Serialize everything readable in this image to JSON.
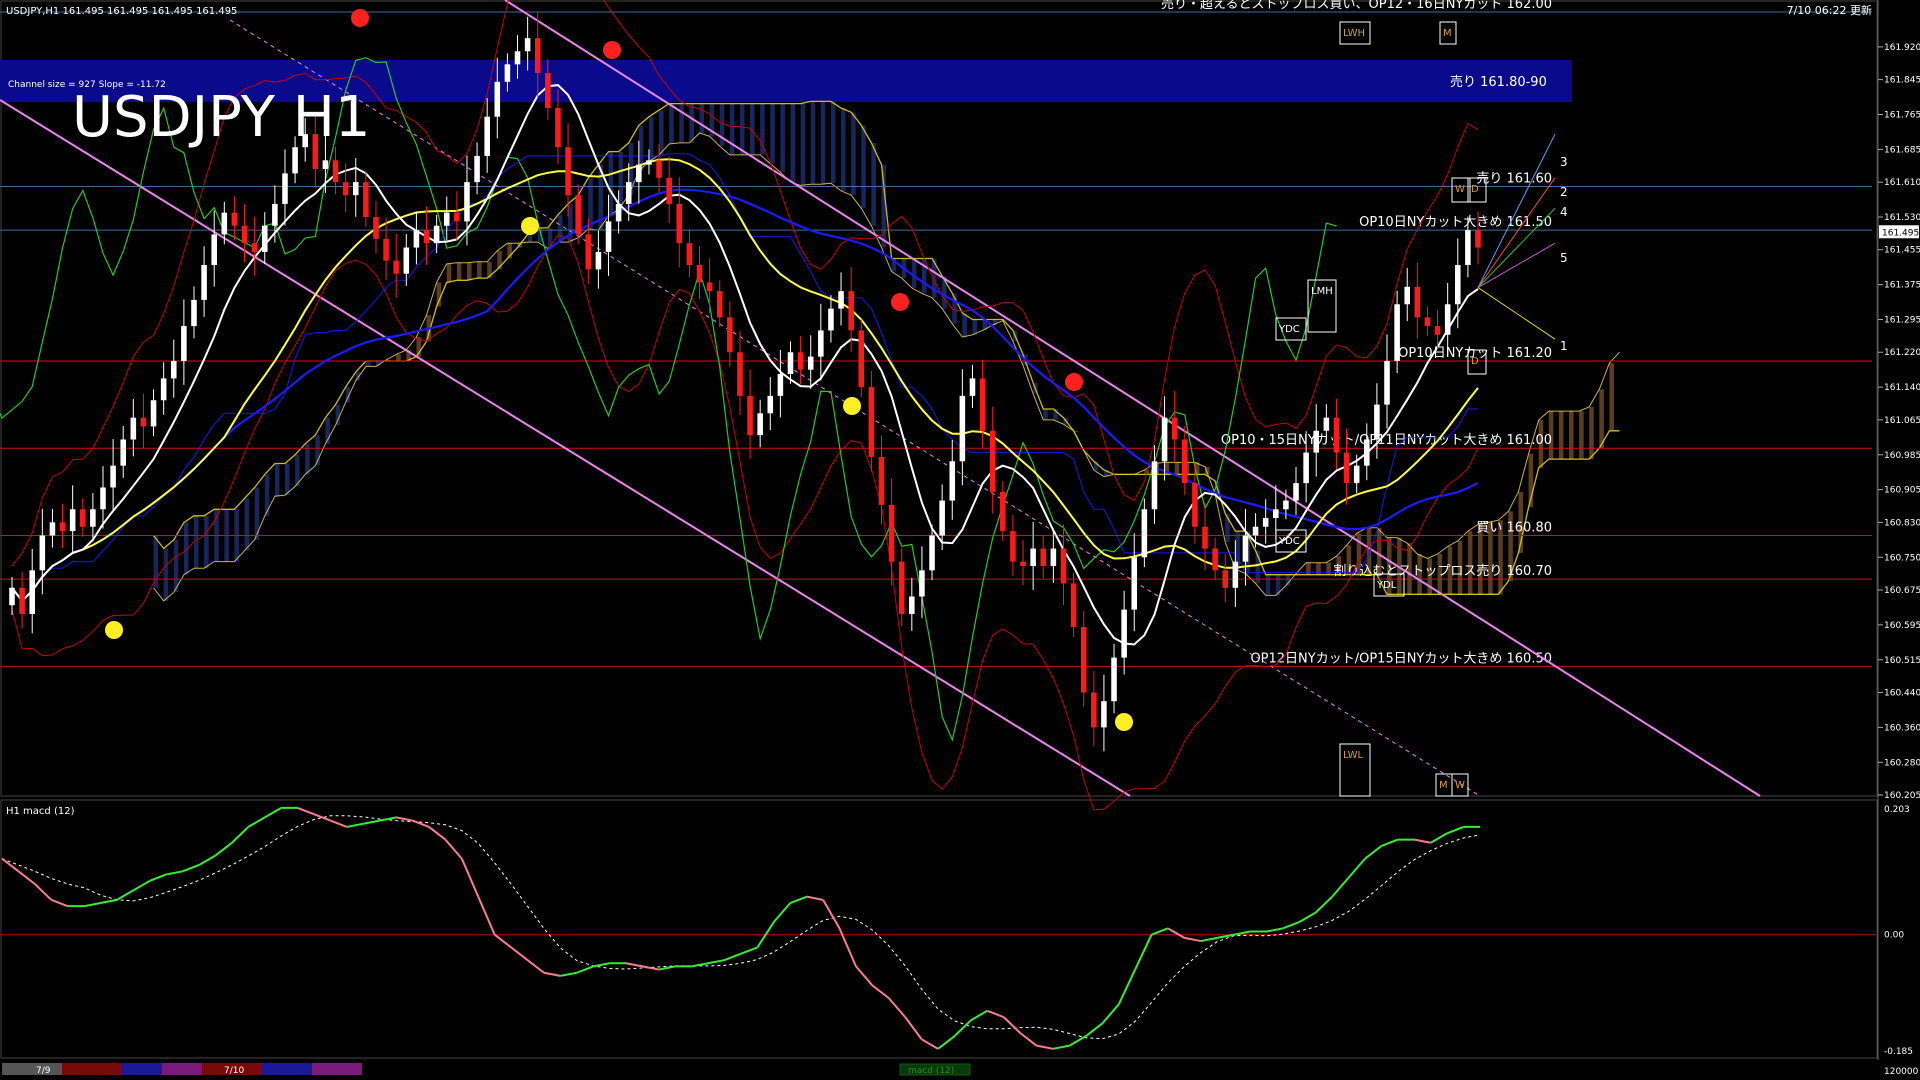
{
  "window": {
    "symbol_info": "USDJPY,H1  161.495 161.495 161.495 161.495",
    "updated": "7/10 06:22 更新",
    "channel_info": "Channel size = 927  Slope = -11.72",
    "big_title": "USDJPY H1",
    "sub_title": "H1  macd (12)",
    "macd_tab": "macd (12)"
  },
  "colors": {
    "background": "#000000",
    "bull_candle": "#ffffff",
    "bear_candle": "#ff1a1a",
    "sell_zone": "#0a0a8c",
    "ma_white": "#ffffff",
    "ma_yellow": "#ffff33",
    "ma_blue": "#1a1aff",
    "channel": "#ee82ee",
    "chikou": "#22cc22",
    "bollinger": "#cc0000",
    "kumo_bull": "#cc8844",
    "kumo_bear": "#3355cc",
    "macd_up": "#33ee33",
    "macd_down": "#ff7a90",
    "signal": "#ffffff",
    "ref_blue": "#3a6ea5",
    "ref_red": "#d01010",
    "marker_gold": "#d6a020"
  },
  "chart_data": {
    "type": "candlestick",
    "title": "USDJPY H1",
    "price_axis": {
      "min": 160.205,
      "max": 162.0,
      "labels": [
        "161.920",
        "161.845",
        "161.765",
        "161.685",
        "161.610",
        "161.530",
        "161.455",
        "161.375",
        "161.295",
        "161.220",
        "161.140",
        "161.065",
        "160.985",
        "160.905",
        "160.830",
        "160.750",
        "160.675",
        "160.595",
        "160.515",
        "160.440",
        "160.360",
        "160.280",
        "160.205"
      ],
      "current_price": "161.495"
    },
    "time_axis": {
      "labels": [
        "7/9",
        "7/10"
      ]
    },
    "levels": [
      {
        "price": 162.0,
        "label": "売り・超えるとストップロス買い、OP12・16日NYカット 162.00",
        "style": "blue"
      },
      {
        "price": 161.6,
        "label": "売り 161.60",
        "style": "blue"
      },
      {
        "price": 161.5,
        "label": "OP10日NYカット大きめ 161.50",
        "style": "blue"
      },
      {
        "price": 161.2,
        "label": "OP10日NYカット 161.20",
        "style": "red"
      },
      {
        "price": 161.0,
        "label": "OP10・15日NYカット/OP11日NYカット大きめ 161.00",
        "style": "red"
      },
      {
        "price": 160.8,
        "label": "買い 160.80",
        "style": "red"
      },
      {
        "price": 160.7,
        "label": "割り込むとストップロス売り 160.70",
        "style": "red"
      },
      {
        "price": 160.5,
        "label": "OP12日NYカット/OP15日NYカット大きめ 160.50",
        "style": "red"
      }
    ],
    "sell_zone": {
      "low": 161.8,
      "high": 161.9,
      "label": "売り 161.80-90"
    },
    "markers": [
      "LWH",
      "M",
      "YDC",
      "LMH",
      "YDC",
      "YDL",
      "LWL",
      "M",
      "W",
      "W",
      "D",
      "D"
    ],
    "projection_labels": [
      "3",
      "2",
      "4",
      "5",
      "1"
    ],
    "close": [
      160.68,
      160.62,
      160.72,
      160.8,
      160.83,
      160.81,
      160.86,
      160.82,
      160.86,
      160.91,
      160.96,
      161.02,
      161.07,
      161.05,
      161.11,
      161.16,
      161.2,
      161.28,
      161.34,
      161.42,
      161.49,
      161.54,
      161.51,
      161.47,
      161.45,
      161.51,
      161.56,
      161.63,
      161.69,
      161.72,
      161.64,
      161.66,
      161.61,
      161.58,
      161.61,
      161.53,
      161.48,
      161.43,
      161.4,
      161.46,
      161.5,
      161.47,
      161.51,
      161.54,
      161.52,
      161.61,
      161.67,
      161.76,
      161.84,
      161.88,
      161.91,
      161.94,
      161.86,
      161.78,
      161.69,
      161.58,
      161.49,
      161.41,
      161.45,
      161.52,
      161.56,
      161.61,
      161.65,
      161.66,
      161.62,
      161.56,
      161.47,
      161.42,
      161.38,
      161.36,
      161.3,
      161.22,
      161.12,
      161.03,
      161.08,
      161.12,
      161.17,
      161.22,
      161.18,
      161.21,
      161.27,
      161.32,
      161.36,
      161.27,
      161.14,
      160.98,
      160.87,
      160.74,
      160.62,
      160.66,
      160.72,
      160.8,
      160.88,
      160.97,
      161.12,
      161.16,
      161.04,
      160.9,
      160.81,
      160.74,
      160.73,
      160.77,
      160.73,
      160.77,
      160.69,
      160.59,
      160.44,
      160.36,
      160.42,
      160.52,
      160.63,
      160.75,
      160.86,
      160.97,
      161.07,
      161.02,
      160.92,
      160.82,
      160.77,
      160.72,
      160.68,
      160.74,
      160.8,
      160.82,
      160.84,
      160.86,
      160.88,
      160.92,
      160.99,
      161.04,
      161.07,
      160.99,
      160.92,
      160.96,
      161.02,
      161.1,
      161.2,
      161.33,
      161.37,
      161.3,
      161.28,
      161.26,
      161.33,
      161.42,
      161.5,
      161.46
    ],
    "macd": [
      0.12,
      0.1,
      0.08,
      0.055,
      0.045,
      0.045,
      0.05,
      0.055,
      0.07,
      0.085,
      0.095,
      0.1,
      0.11,
      0.125,
      0.145,
      0.17,
      0.185,
      0.2,
      0.2,
      0.19,
      0.18,
      0.17,
      0.175,
      0.18,
      0.185,
      0.18,
      0.17,
      0.15,
      0.12,
      0.06,
      0.0,
      -0.02,
      -0.04,
      -0.06,
      -0.065,
      -0.06,
      -0.05,
      -0.045,
      -0.045,
      -0.05,
      -0.055,
      -0.05,
      -0.05,
      -0.045,
      -0.04,
      -0.03,
      -0.02,
      0.02,
      0.05,
      0.06,
      0.055,
      0.01,
      -0.05,
      -0.08,
      -0.1,
      -0.13,
      -0.165,
      -0.18,
      -0.16,
      -0.135,
      -0.12,
      -0.13,
      -0.155,
      -0.175,
      -0.18,
      -0.175,
      -0.16,
      -0.14,
      -0.11,
      -0.055,
      0.0,
      0.01,
      -0.005,
      -0.01,
      -0.005,
      0.0,
      0.005,
      0.005,
      0.01,
      0.02,
      0.035,
      0.06,
      0.09,
      0.12,
      0.14,
      0.15,
      0.15,
      0.145,
      0.16,
      0.17,
      0.17
    ],
    "macd_axis": {
      "max": 0.203,
      "zero": "0.00",
      "min": -0.185,
      "labels": [
        "0.203",
        "0.00",
        "-0.185"
      ],
      "footer": "120000"
    }
  }
}
